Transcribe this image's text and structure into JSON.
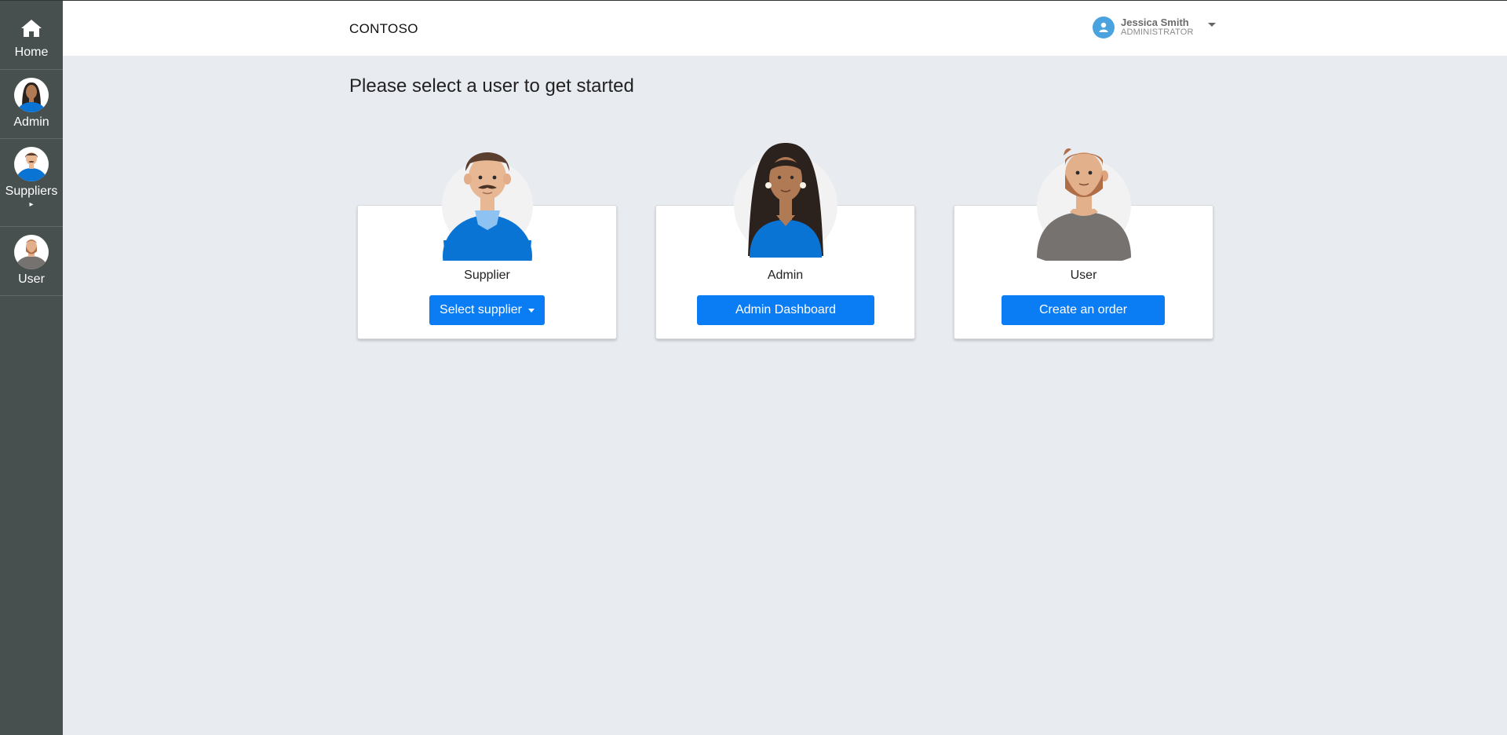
{
  "sidebar": {
    "items": [
      {
        "label": "Home",
        "icon": "home-icon"
      },
      {
        "label": "Admin",
        "icon": "admin-avatar"
      },
      {
        "label": "Suppliers",
        "icon": "supplier-avatar"
      },
      {
        "label": "User",
        "icon": "user-avatar"
      }
    ]
  },
  "header": {
    "brand": "CONTOSO",
    "profile": {
      "name": "Jessica Smith",
      "role": "ADMINISTRATOR"
    }
  },
  "main": {
    "title": "Please select a user to get started",
    "cards": [
      {
        "label": "Supplier",
        "button": "Select supplier"
      },
      {
        "label": "Admin",
        "button": "Admin Dashboard"
      },
      {
        "label": "User",
        "button": "Create an order"
      }
    ]
  },
  "colors": {
    "sidebar": "#474f4f",
    "background": "#e8ebf0",
    "primary": "#0a7cf4",
    "shirt_blue": "#0a74d4",
    "shirt_gray": "#767270"
  }
}
